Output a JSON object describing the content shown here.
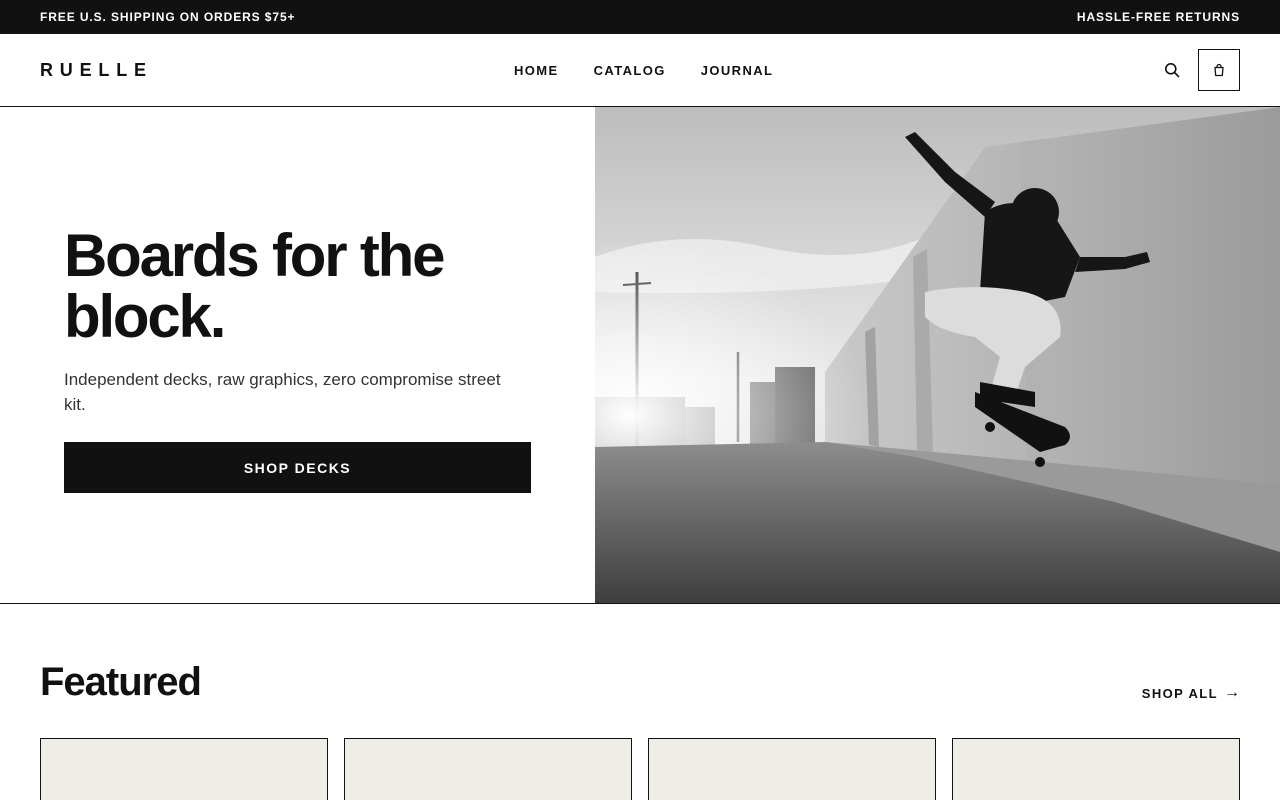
{
  "announcement": {
    "left": "FREE U.S. SHIPPING ON ORDERS $75+",
    "right": "HASSLE-FREE RETURNS"
  },
  "header": {
    "logo": "RUELLE",
    "nav": [
      "HOME",
      "CATALOG",
      "JOURNAL"
    ],
    "icons": [
      "search-icon",
      "shopping-bag-icon"
    ]
  },
  "hero": {
    "title_line1": "Boards for the",
    "title_line2": "block.",
    "subtitle": "Independent decks, raw graphics, zero compromise street kit.",
    "cta": "SHOP DECKS",
    "image": "skateboarder-photo"
  },
  "featured": {
    "title": "Featured",
    "shop_all": "SHOP ALL",
    "arrow": "→",
    "cards": [
      {},
      {},
      {},
      {}
    ]
  },
  "colors": {
    "ink": "#111111",
    "paper": "#ffffff",
    "card_bg": "#efede8"
  }
}
